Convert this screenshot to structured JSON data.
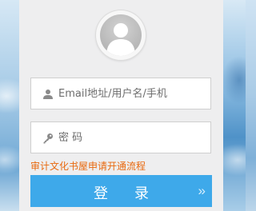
{
  "login_form": {
    "avatar_icon": "user-avatar-icon",
    "username": {
      "icon": "user-icon",
      "placeholder": "Email地址/用户名/手机",
      "value": ""
    },
    "password": {
      "icon": "key-icon",
      "placeholder": "密 码",
      "value": ""
    },
    "apply_link": "审计文化书屋申请开通流程",
    "login_button": {
      "label": "登 录",
      "arrow_icon": "double-chevron-right-icon"
    }
  },
  "colors": {
    "accent": "#3ea9ea",
    "link": "#e8690f",
    "panel": "#eeeeef"
  }
}
